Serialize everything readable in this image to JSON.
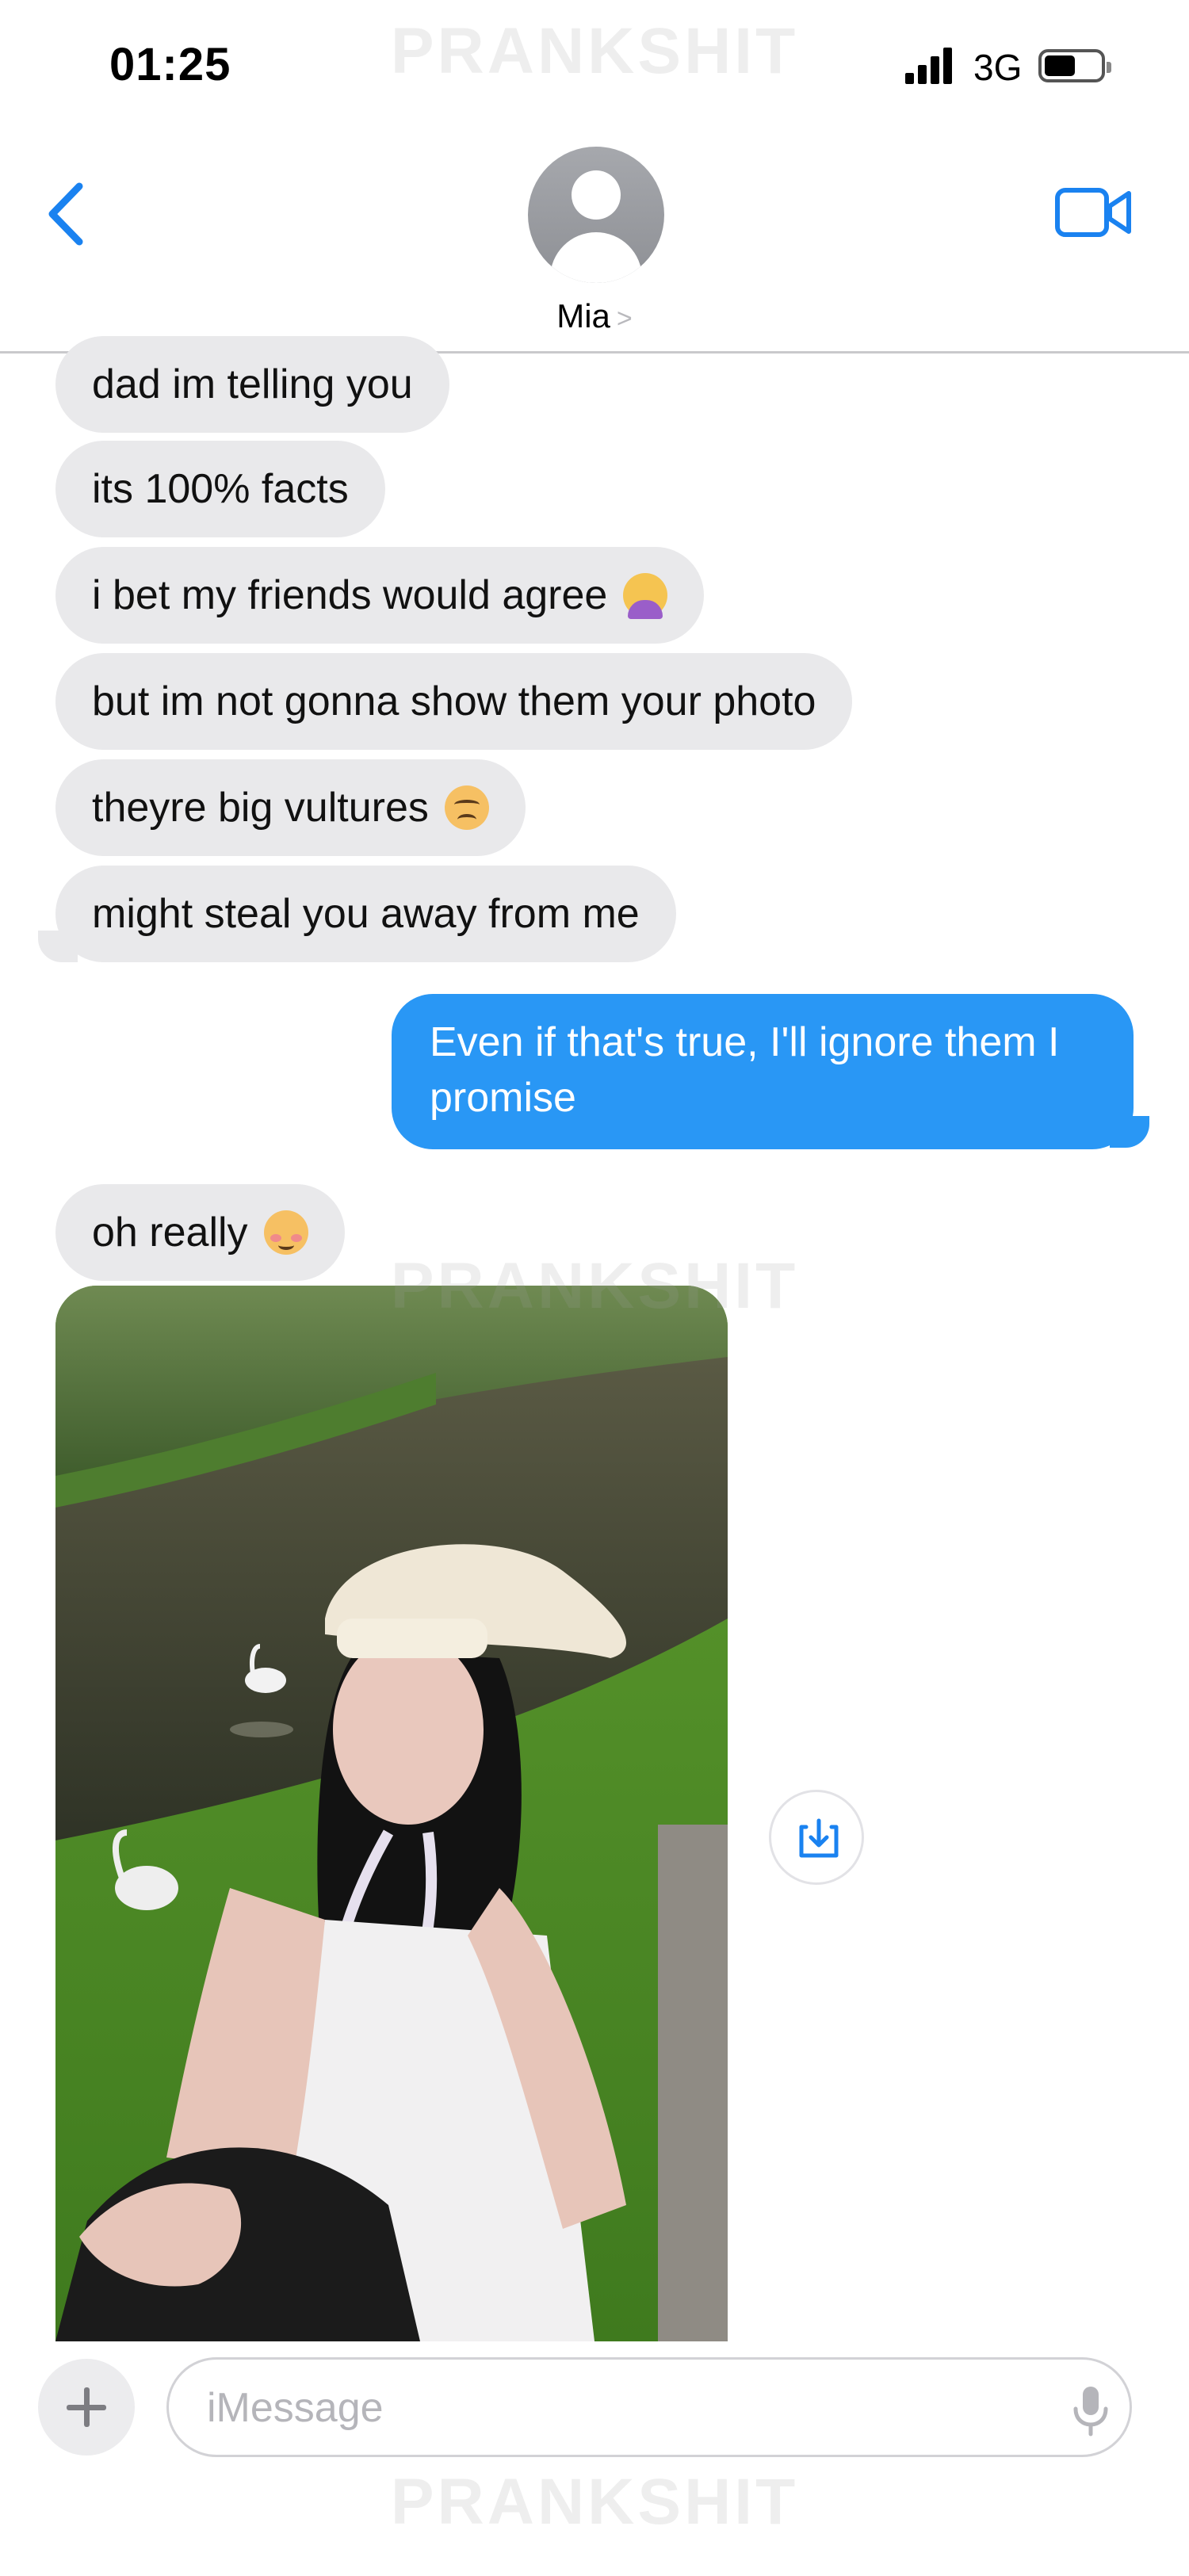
{
  "status_bar": {
    "time": "01:25",
    "network": "3G"
  },
  "watermark": "PRANKSHIT",
  "header": {
    "contact_name": "Mia",
    "chevron": ">"
  },
  "messages": [
    {
      "direction": "incoming",
      "text": "dad im telling you"
    },
    {
      "direction": "incoming",
      "text": "its 100% facts"
    },
    {
      "direction": "incoming",
      "text": "i bet my friends would agree",
      "emoji": "person-gesturing-icon"
    },
    {
      "direction": "incoming",
      "text": "but im not gonna show them your photo"
    },
    {
      "direction": "incoming",
      "text": "theyre big vultures",
      "emoji": "sad-face-icon"
    },
    {
      "direction": "incoming",
      "text": "might steal you away from me"
    },
    {
      "direction": "outgoing",
      "text": "Even if that's true, I'll ignore them I promise"
    },
    {
      "direction": "incoming",
      "text": "oh really",
      "emoji": "relieved-face-icon"
    }
  ],
  "photo": {
    "description_icon": "photo-attachment"
  },
  "composer": {
    "placeholder": "iMessage"
  },
  "colors": {
    "accent": "#1a82f0",
    "outgoing_bubble": "#2997f5",
    "incoming_bubble": "#e9e9eb"
  }
}
